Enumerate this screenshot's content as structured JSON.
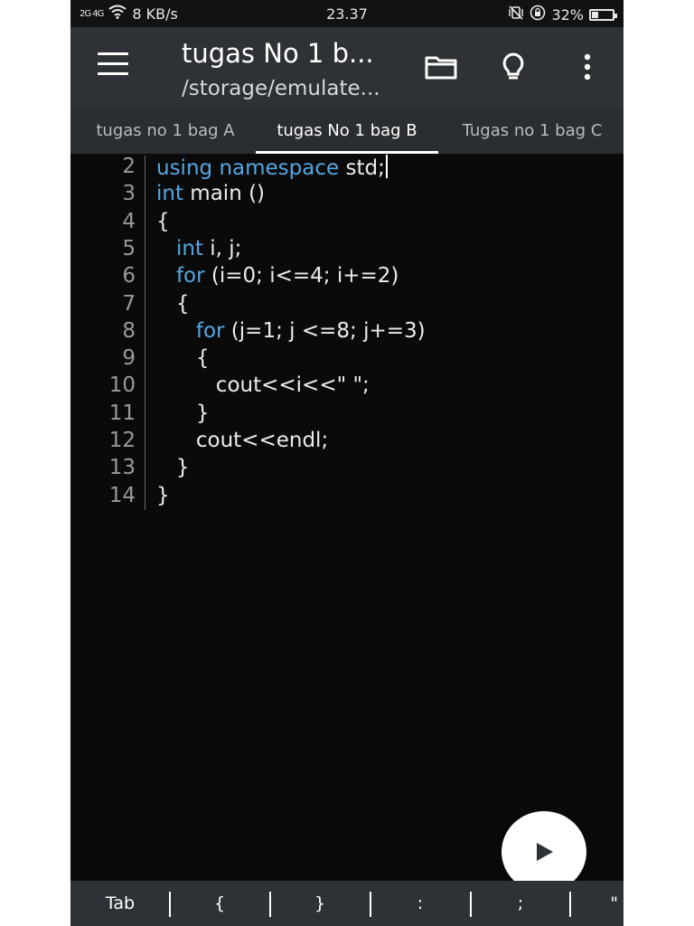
{
  "status_bar": {
    "signal": "2G 4G",
    "speed": "8 KB/s",
    "time": "23.37",
    "battery": "32%",
    "battery_level": 0.32
  },
  "app_bar": {
    "title": "tugas No 1 b...",
    "subtitle": "/storage/emulate..."
  },
  "tabs": [
    {
      "label": "tugas no 1 bag A",
      "active": false
    },
    {
      "label": "tugas No 1 bag B",
      "active": true
    },
    {
      "label": "Tugas no 1 bag C",
      "active": false
    }
  ],
  "code_lines": [
    {
      "num": "2",
      "text": "using namespace std;"
    },
    {
      "num": "3",
      "text": "int main ()"
    },
    {
      "num": "4",
      "text": "{"
    },
    {
      "num": "5",
      "text": "   int i, j;"
    },
    {
      "num": "6",
      "text": "   for (i=0; i<=4; i+=2)"
    },
    {
      "num": "7",
      "text": "   {"
    },
    {
      "num": "8",
      "text": "      for (j=1; j <=8; j+=3)"
    },
    {
      "num": "9",
      "text": "      {"
    },
    {
      "num": "10",
      "text": "         cout<<i<<\" \";"
    },
    {
      "num": "11",
      "text": "      }"
    },
    {
      "num": "12",
      "text": "      cout<<endl;"
    },
    {
      "num": "13",
      "text": "   }"
    },
    {
      "num": "14",
      "text": "}"
    }
  ],
  "symbols": [
    "Tab",
    "{",
    "}",
    ":",
    ";",
    "\""
  ],
  "icons": {
    "menu": "menu-icon",
    "folder": "folder-icon",
    "lightbulb": "lightbulb-icon",
    "more": "more-vertical-icon",
    "run": "play-icon",
    "wifi": "wifi-icon",
    "mute": "vibrate-off-icon",
    "rotation_lock": "rotation-lock-icon",
    "battery": "battery-icon"
  },
  "colors": {
    "keyword": "#56a6e2",
    "app_bar": "#2e3236",
    "editor_bg": "#0a0a0a"
  }
}
